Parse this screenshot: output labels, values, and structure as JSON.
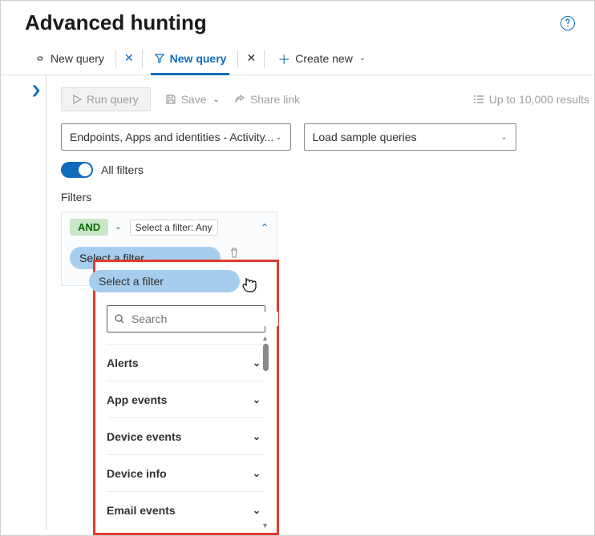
{
  "header": {
    "title": "Advanced hunting"
  },
  "tabs": {
    "items": [
      {
        "label": "New query",
        "active": false
      },
      {
        "label": "New query",
        "active": true
      }
    ],
    "create_label": "Create new"
  },
  "toolbar": {
    "run": "Run query",
    "save": "Save",
    "share": "Share link",
    "limit": "Up to 10,000 results"
  },
  "scope_dropdown": {
    "label": "Endpoints, Apps and identities - Activity..."
  },
  "sample_dropdown": {
    "label": "Load sample queries"
  },
  "toggle": {
    "label": "All filters"
  },
  "filters_section": {
    "label": "Filters"
  },
  "condition": {
    "op": "AND",
    "hint": "Select a filter: Any"
  },
  "select_filter": {
    "label": "Select a filter"
  },
  "search": {
    "placeholder": "Search"
  },
  "categories": [
    {
      "label": "Alerts"
    },
    {
      "label": "App events"
    },
    {
      "label": "Device events"
    },
    {
      "label": "Device info"
    },
    {
      "label": "Email events"
    }
  ]
}
